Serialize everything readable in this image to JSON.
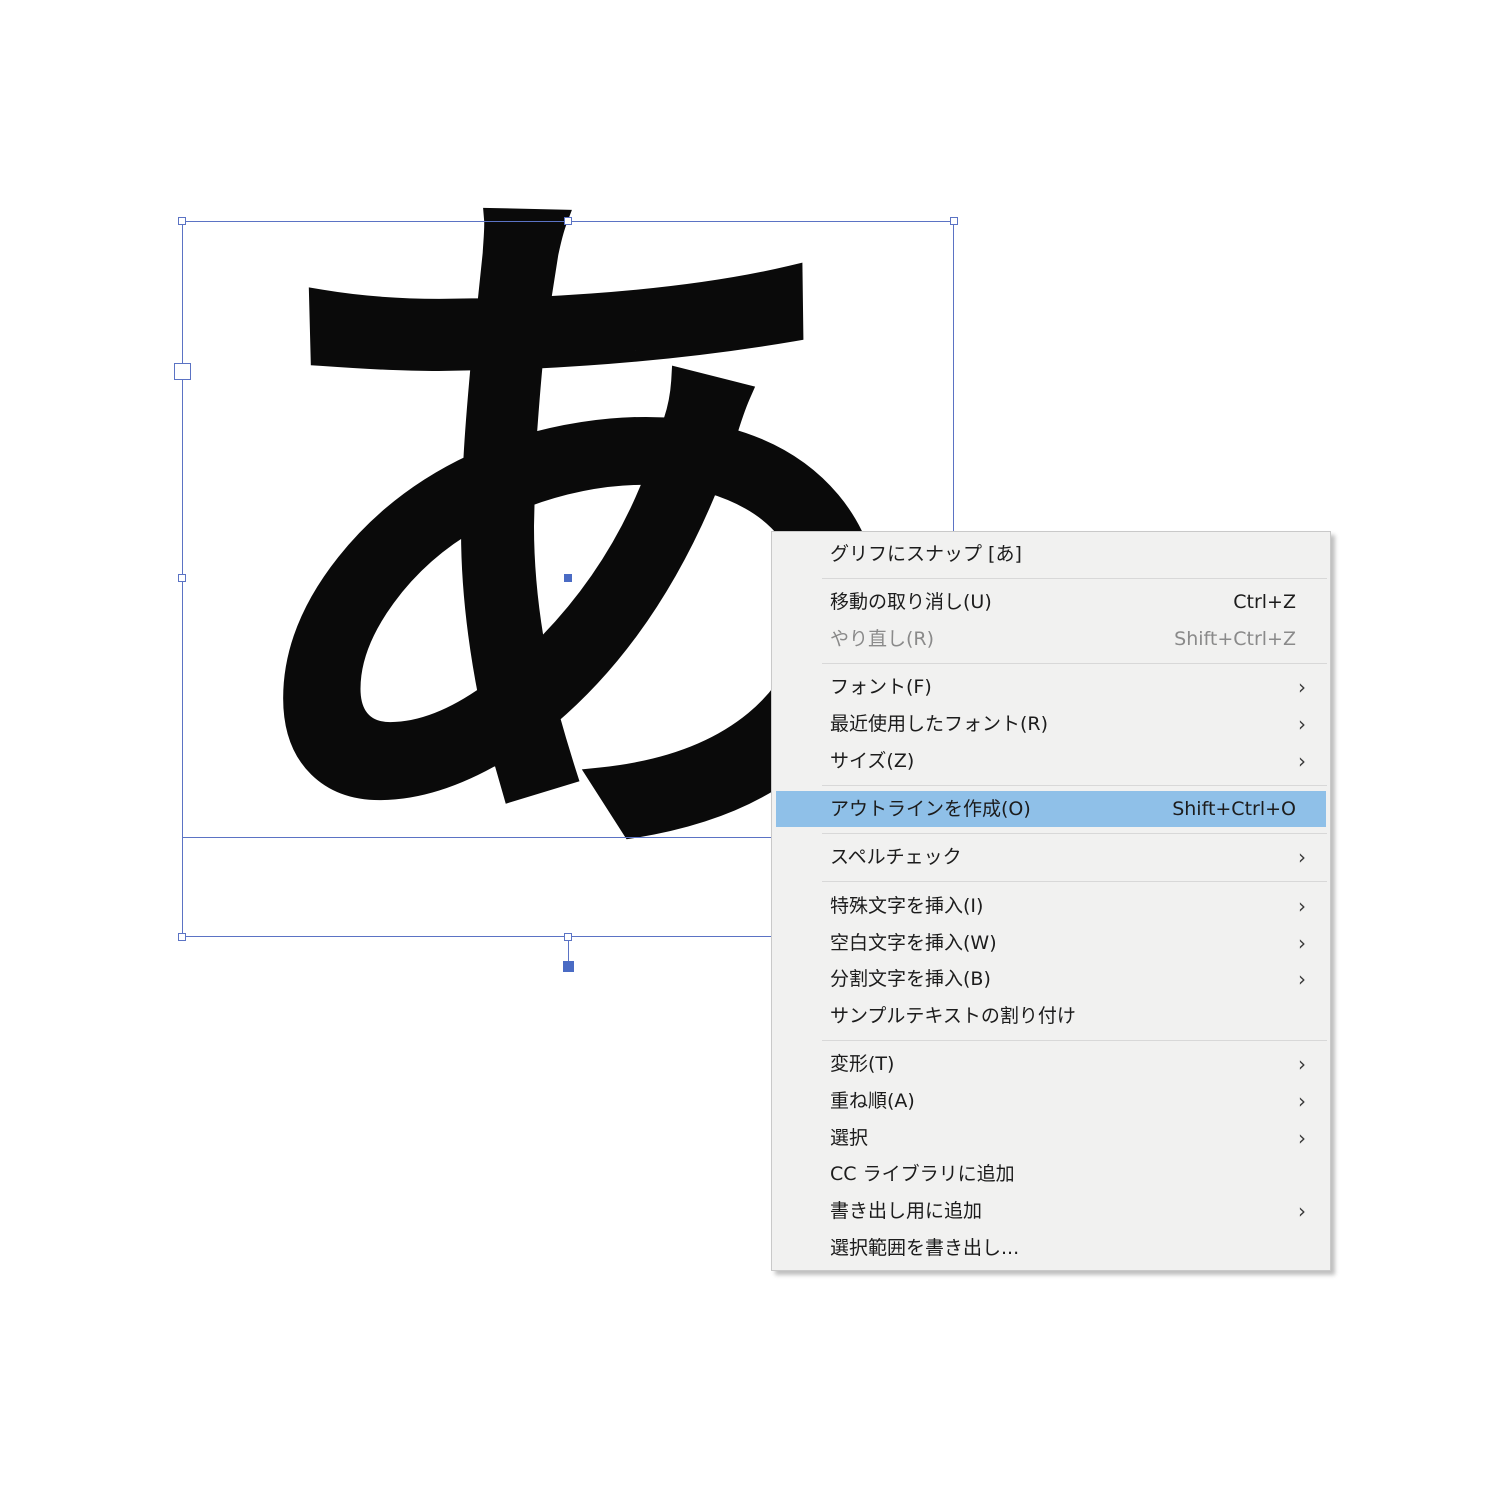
{
  "canvas": {
    "glyph": "あ"
  },
  "menu": {
    "snap_glyph": {
      "label": "グリフにスナップ [あ]"
    },
    "undo": {
      "label": "移動の取り消し(U)",
      "shortcut": "Ctrl+Z"
    },
    "redo": {
      "label": "やり直し(R)",
      "shortcut": "Shift+Ctrl+Z",
      "enabled": false
    },
    "font": {
      "label": "フォント(F)",
      "submenu_icon": "chevron-right-icon"
    },
    "recent_fonts": {
      "label": "最近使用したフォント(R)",
      "submenu_icon": "chevron-right-icon"
    },
    "size": {
      "label": "サイズ(Z)",
      "submenu_icon": "chevron-right-icon"
    },
    "create_outlines": {
      "label": "アウトラインを作成(O)",
      "shortcut": "Shift+Ctrl+O",
      "highlighted": true
    },
    "spell_check": {
      "label": "スペルチェック",
      "submenu_icon": "chevron-right-icon"
    },
    "insert_special": {
      "label": "特殊文字を挿入(I)",
      "submenu_icon": "chevron-right-icon"
    },
    "insert_whitespace": {
      "label": "空白文字を挿入(W)",
      "submenu_icon": "chevron-right-icon"
    },
    "insert_break": {
      "label": "分割文字を挿入(B)",
      "submenu_icon": "chevron-right-icon"
    },
    "fill_placeholder": {
      "label": "サンプルテキストの割り付け"
    },
    "transform": {
      "label": "変形(T)",
      "submenu_icon": "chevron-right-icon"
    },
    "arrange": {
      "label": "重ね順(A)",
      "submenu_icon": "chevron-right-icon"
    },
    "select": {
      "label": "選択",
      "submenu_icon": "chevron-right-icon"
    },
    "add_cc_library": {
      "label": "CC ライブラリに追加"
    },
    "collect_export": {
      "label": "書き出し用に追加",
      "submenu_icon": "chevron-right-icon"
    },
    "export_selection": {
      "label": "選択範囲を書き出し..."
    }
  },
  "colors": {
    "selection": "#5b73c4",
    "menu_background": "#f1f1f0",
    "menu_highlight": "#8fc0e8",
    "glyph": "#0a0a0a",
    "disabled_text": "#8a8a8a"
  }
}
